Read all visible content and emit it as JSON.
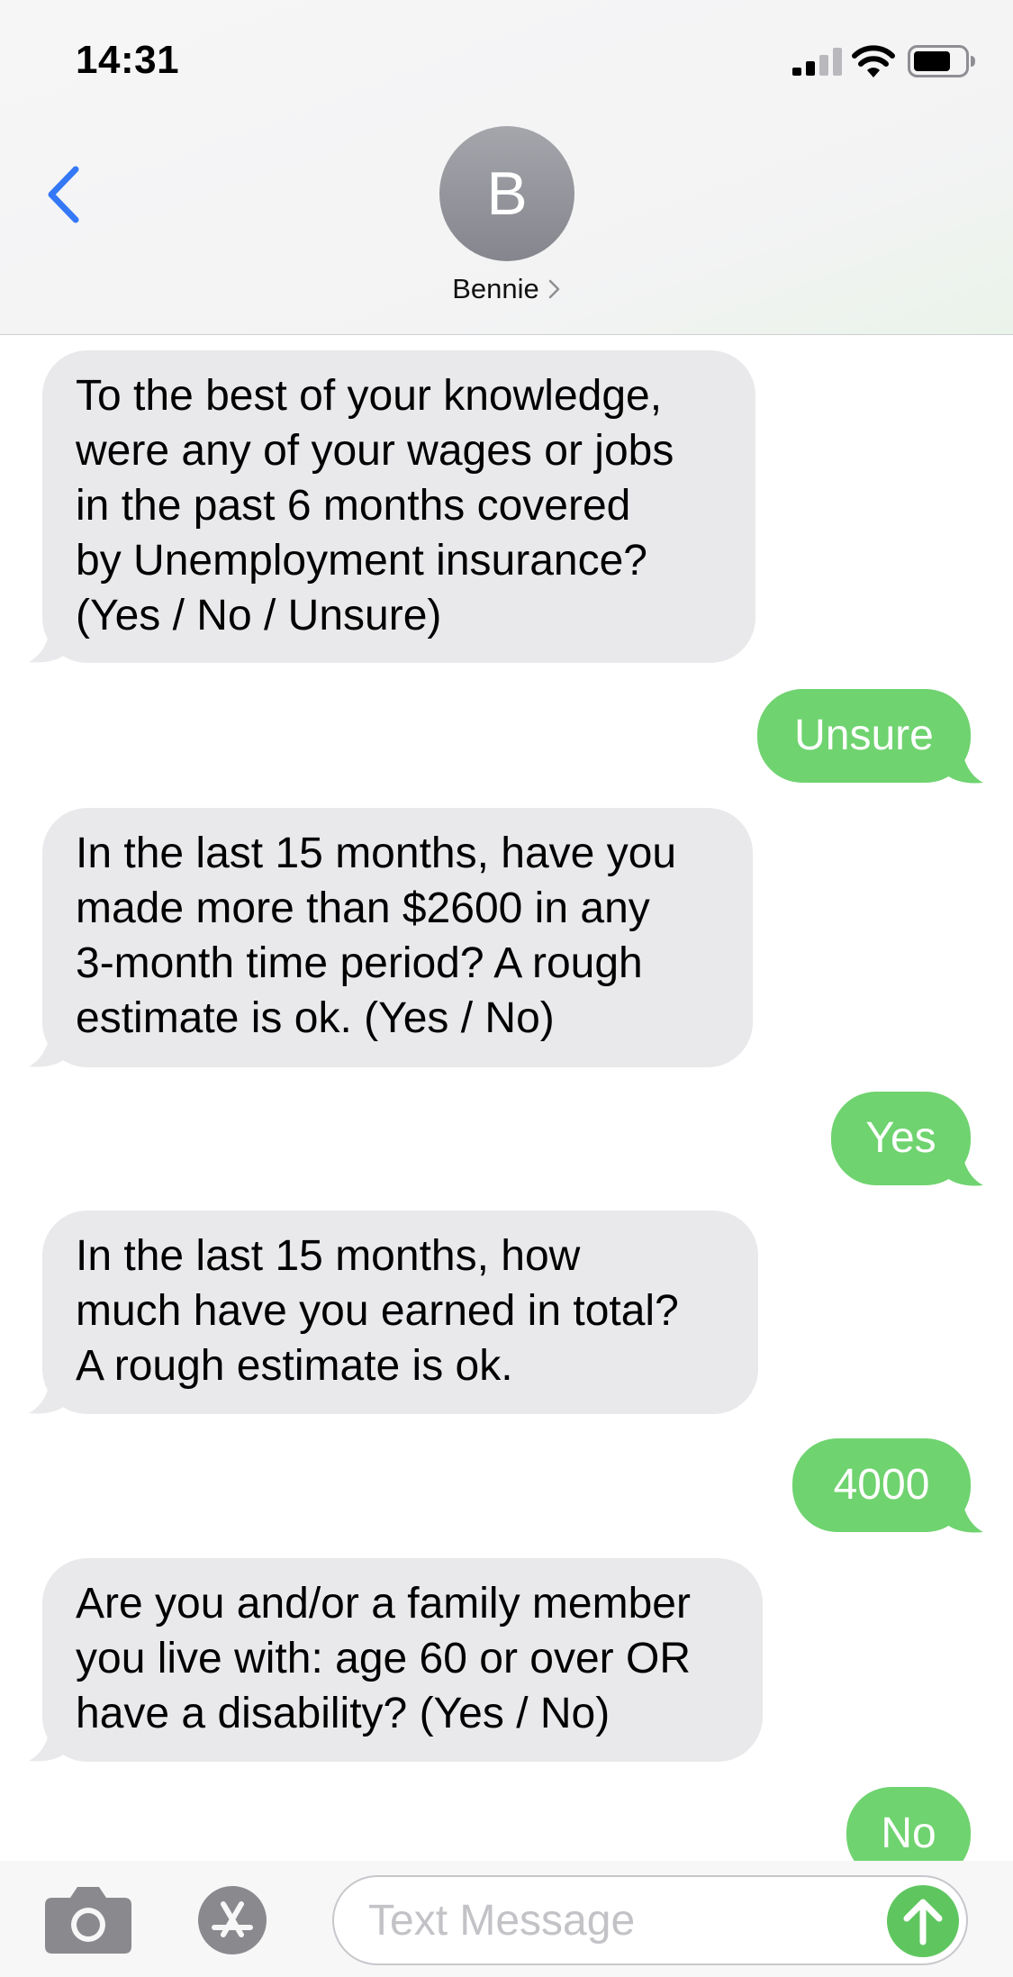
{
  "status_bar": {
    "time": "14:31",
    "icons": [
      "signal-icon",
      "wifi-icon",
      "battery-icon"
    ]
  },
  "header": {
    "back_icon": "chevron-left-icon",
    "avatar_initial": "B",
    "contact_name": "Bennie",
    "contact_chevron_icon": "chevron-right-icon"
  },
  "messages": [
    {
      "direction": "incoming",
      "text": "To the best of your knowledge,\nwere any of your wages or jobs\nin the past 6 months covered\nby Unemployment insurance?\n(Yes / No / Unsure)"
    },
    {
      "direction": "outgoing",
      "text": "Unsure"
    },
    {
      "direction": "incoming",
      "text": "In the last 15 months, have you\nmade more than $2600 in any\n3-month time period? A rough\nestimate is ok.  (Yes / No)"
    },
    {
      "direction": "outgoing",
      "text": "Yes"
    },
    {
      "direction": "incoming",
      "text": "In the last 15 months, how\nmuch have you earned in total?\nA rough estimate is ok."
    },
    {
      "direction": "outgoing",
      "text": "4000"
    },
    {
      "direction": "incoming",
      "text": "Are you and/or a family member\nyou live with: age 60 or over OR\nhave a disability? (Yes / No)"
    },
    {
      "direction": "outgoing",
      "text": "No"
    }
  ],
  "input_bar": {
    "camera_icon": "camera-icon",
    "apps_icon": "app-store-icon",
    "placeholder": "Text Message",
    "value": "",
    "send_icon": "arrow-up-icon"
  },
  "colors": {
    "incoming_bubble": "#e9e9eb",
    "outgoing_bubble": "#6fd36f",
    "accent_blue": "#3478f6",
    "send_green": "#5fc65f"
  }
}
